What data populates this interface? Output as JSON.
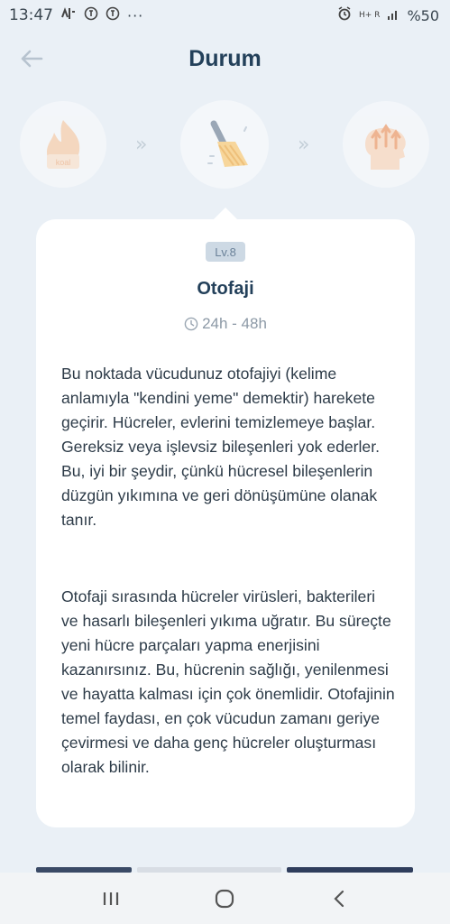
{
  "status_bar": {
    "time": "13:47",
    "notification_dots": "···",
    "signal": "H+ R",
    "battery": "%50"
  },
  "header": {
    "title": "Durum"
  },
  "stages": [
    {
      "name": "fat-burning",
      "label": "koal",
      "state": "inactive"
    },
    {
      "name": "autophagy",
      "state": "active"
    },
    {
      "name": "growth-hormone",
      "state": "inactive"
    }
  ],
  "card": {
    "level": "Lv.8",
    "title": "Otofaji",
    "duration": "24h - 48h",
    "paragraph_1": "Bu noktada vücudunuz otofajiyi (kelime anlamıyla \"kendini yeme\" demektir) harekete geçirir. Hücreler, evlerini temizlemeye başlar. Gereksiz veya işlevsiz bileşenleri yok ederler. Bu, iyi bir şeydir, çünkü hücresel bileşenlerin düzgün yıkımına ve geri dönüşümüne olanak tanır.",
    "paragraph_2": "Otofaji sırasında hücreler virüsleri, bakterileri ve hasarlı bileşenleri yıkıma uğratır. Bu süreçte yeni hücre parçaları yapma enerjisini kazanırsınız. Bu, hücrenin sağlığı, yenilenmesi ve hayatta kalması için çok önemlidir. Otofajinin temel faydası, en çok vücudun zamanı geriye çevirmesi ve daha genç hücreler oluşturması olarak bilinir."
  },
  "colors": {
    "background": "#eaf0f6",
    "title": "#23405a",
    "badge_bg": "#cdd9e4",
    "accent_orange": "#f5b68c"
  }
}
